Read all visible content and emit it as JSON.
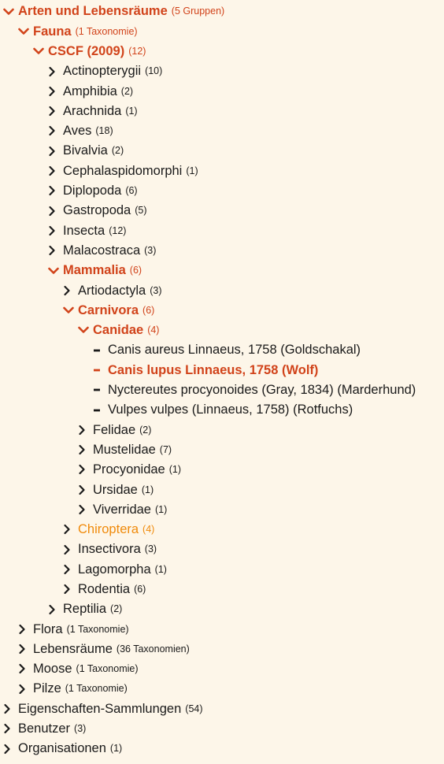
{
  "colors": {
    "accent": "#d1431a",
    "hover": "#f08a0a",
    "text": "#1a1a1a",
    "background": "#fdf6e9"
  },
  "tree": [
    {
      "label": "Arten und Lebensräume",
      "count": "(5 Gruppen)",
      "depth": 0,
      "icon": "chevron-down-icon",
      "state": "open"
    },
    {
      "label": "Fauna",
      "count": "(1 Taxonomie)",
      "depth": 1,
      "icon": "chevron-down-icon",
      "state": "open"
    },
    {
      "label": "CSCF (2009)",
      "count": "(12)",
      "depth": 2,
      "icon": "chevron-down-icon",
      "state": "open"
    },
    {
      "label": "Actinopterygii",
      "count": "(10)",
      "depth": 3,
      "icon": "chevron-right-icon",
      "state": "closed"
    },
    {
      "label": "Amphibia",
      "count": "(2)",
      "depth": 3,
      "icon": "chevron-right-icon",
      "state": "closed"
    },
    {
      "label": "Arachnida",
      "count": "(1)",
      "depth": 3,
      "icon": "chevron-right-icon",
      "state": "closed"
    },
    {
      "label": "Aves",
      "count": "(18)",
      "depth": 3,
      "icon": "chevron-right-icon",
      "state": "closed"
    },
    {
      "label": "Bivalvia",
      "count": "(2)",
      "depth": 3,
      "icon": "chevron-right-icon",
      "state": "closed"
    },
    {
      "label": "Cephalaspidomorphi",
      "count": "(1)",
      "depth": 3,
      "icon": "chevron-right-icon",
      "state": "closed"
    },
    {
      "label": "Diplopoda",
      "count": "(6)",
      "depth": 3,
      "icon": "chevron-right-icon",
      "state": "closed"
    },
    {
      "label": "Gastropoda",
      "count": "(5)",
      "depth": 3,
      "icon": "chevron-right-icon",
      "state": "closed"
    },
    {
      "label": "Insecta",
      "count": "(12)",
      "depth": 3,
      "icon": "chevron-right-icon",
      "state": "closed"
    },
    {
      "label": "Malacostraca",
      "count": "(3)",
      "depth": 3,
      "icon": "chevron-right-icon",
      "state": "closed"
    },
    {
      "label": "Mammalia",
      "count": "(6)",
      "depth": 3,
      "icon": "chevron-down-icon",
      "state": "open"
    },
    {
      "label": "Artiodactyla",
      "count": "(3)",
      "depth": 4,
      "icon": "chevron-right-icon",
      "state": "closed"
    },
    {
      "label": "Carnivora",
      "count": "(6)",
      "depth": 4,
      "icon": "chevron-down-icon",
      "state": "open"
    },
    {
      "label": "Canidae",
      "count": "(4)",
      "depth": 5,
      "icon": "chevron-down-icon",
      "state": "open"
    },
    {
      "label": "Canis aureus Linnaeus, 1758 (Goldschakal)",
      "count": "",
      "depth": 6,
      "icon": "dash-icon",
      "state": "leaf"
    },
    {
      "label": "Canis lupus Linnaeus, 1758 (Wolf)",
      "count": "",
      "depth": 6,
      "icon": "dash-icon",
      "state": "selected"
    },
    {
      "label": "Nyctereutes procyonoides (Gray, 1834) (Marderhund)",
      "count": "",
      "depth": 6,
      "icon": "dash-icon",
      "state": "leaf"
    },
    {
      "label": "Vulpes vulpes (Linnaeus, 1758) (Rotfuchs)",
      "count": "",
      "depth": 6,
      "icon": "dash-icon",
      "state": "leaf"
    },
    {
      "label": "Felidae",
      "count": "(2)",
      "depth": 5,
      "icon": "chevron-right-icon",
      "state": "closed"
    },
    {
      "label": "Mustelidae",
      "count": "(7)",
      "depth": 5,
      "icon": "chevron-right-icon",
      "state": "closed"
    },
    {
      "label": "Procyonidae",
      "count": "(1)",
      "depth": 5,
      "icon": "chevron-right-icon",
      "state": "closed"
    },
    {
      "label": "Ursidae",
      "count": "(1)",
      "depth": 5,
      "icon": "chevron-right-icon",
      "state": "closed"
    },
    {
      "label": "Viverridae",
      "count": "(1)",
      "depth": 5,
      "icon": "chevron-right-icon",
      "state": "closed"
    },
    {
      "label": "Chiroptera",
      "count": "(4)",
      "depth": 4,
      "icon": "chevron-right-icon",
      "state": "hover"
    },
    {
      "label": "Insectivora",
      "count": "(3)",
      "depth": 4,
      "icon": "chevron-right-icon",
      "state": "closed"
    },
    {
      "label": "Lagomorpha",
      "count": "(1)",
      "depth": 4,
      "icon": "chevron-right-icon",
      "state": "closed"
    },
    {
      "label": "Rodentia",
      "count": "(6)",
      "depth": 4,
      "icon": "chevron-right-icon",
      "state": "closed"
    },
    {
      "label": "Reptilia",
      "count": "(2)",
      "depth": 3,
      "icon": "chevron-right-icon",
      "state": "closed"
    },
    {
      "label": "Flora",
      "count": "(1 Taxonomie)",
      "depth": 1,
      "icon": "chevron-right-icon",
      "state": "closed"
    },
    {
      "label": "Lebensräume",
      "count": "(36 Taxonomien)",
      "depth": 1,
      "icon": "chevron-right-icon",
      "state": "closed"
    },
    {
      "label": "Moose",
      "count": "(1 Taxonomie)",
      "depth": 1,
      "icon": "chevron-right-icon",
      "state": "closed"
    },
    {
      "label": "Pilze",
      "count": "(1 Taxonomie)",
      "depth": 1,
      "icon": "chevron-right-icon",
      "state": "closed"
    },
    {
      "label": "Eigenschaften-Sammlungen",
      "count": "(54)",
      "depth": 0,
      "icon": "chevron-right-icon",
      "state": "closed"
    },
    {
      "label": "Benutzer",
      "count": "(3)",
      "depth": 0,
      "icon": "chevron-right-icon",
      "state": "closed"
    },
    {
      "label": "Organisationen",
      "count": "(1)",
      "depth": 0,
      "icon": "chevron-right-icon",
      "state": "closed"
    }
  ]
}
